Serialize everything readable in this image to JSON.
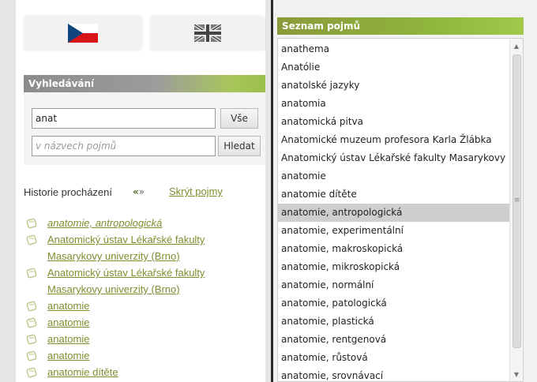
{
  "search": {
    "header": "Vyhledávání",
    "query": "anat",
    "all_button": "Vše",
    "placeholder": "v názvech pojmů",
    "search_button": "Hledat"
  },
  "history": {
    "label": "Historie procházení",
    "hide_link": "Skrýt pojmy",
    "items": [
      "anatomie, antropologická",
      "Anatomický ústav Lékařské fakulty Masarykovy univerzity (Brno)",
      "Anatomický ústav Lékařské fakulty Masarykovy univerzity (Brno)",
      "anatomie",
      "anatomie",
      "anatomie",
      "anatomie",
      "anatomie dítěte"
    ]
  },
  "terms": {
    "header": "Seznam pojmů",
    "items": [
      "anathema",
      "Anatólie",
      "anatolské jazyky",
      "anatomia",
      "anatomická pitva",
      "Anatomické muzeum profesora Karla Žlábka",
      "Anatomický ústav Lékařské fakulty Masarykovy",
      "anatomie",
      "anatomie dítěte",
      "anatomie, antropologická",
      "anatomie, experimentální",
      "anatomie, makroskopická",
      "anatomie, mikroskopická",
      "anatomie, normální",
      "anatomie, patologická",
      "anatomie, plastická",
      "anatomie, rentgenová",
      "anatomie, růstová",
      "anatomie, srovnávací"
    ],
    "selected": "anatomie, antropologická"
  },
  "icons": {
    "cz_flag": "czech-flag-icon",
    "uk_flag": "uk-flag-icon",
    "history_item": "book-icon",
    "back": "back-arrow-icon",
    "forward": "forward-arrow-icon"
  },
  "colors": {
    "link_green": "#7f8d2e",
    "header_green": "#8fb43c",
    "selection_gray": "#cfcfcf"
  }
}
